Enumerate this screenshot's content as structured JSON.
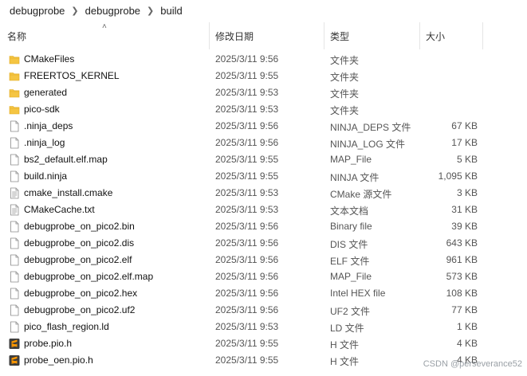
{
  "breadcrumb": [
    "debugprobe",
    "debugprobe",
    "build"
  ],
  "columns": {
    "name": "名称",
    "date": "修改日期",
    "type": "类型",
    "size": "大小"
  },
  "files": [
    {
      "icon": "folder-icon",
      "name": "CMakeFiles",
      "date": "2025/3/11 9:56",
      "type": "文件夹",
      "size": ""
    },
    {
      "icon": "folder-icon",
      "name": "FREERTOS_KERNEL",
      "date": "2025/3/11 9:55",
      "type": "文件夹",
      "size": ""
    },
    {
      "icon": "folder-icon",
      "name": "generated",
      "date": "2025/3/11 9:53",
      "type": "文件夹",
      "size": ""
    },
    {
      "icon": "folder-icon",
      "name": "pico-sdk",
      "date": "2025/3/11 9:53",
      "type": "文件夹",
      "size": ""
    },
    {
      "icon": "file-icon",
      "name": ".ninja_deps",
      "date": "2025/3/11 9:56",
      "type": "NINJA_DEPS 文件",
      "size": "67 KB"
    },
    {
      "icon": "file-icon",
      "name": ".ninja_log",
      "date": "2025/3/11 9:56",
      "type": "NINJA_LOG 文件",
      "size": "17 KB"
    },
    {
      "icon": "file-icon",
      "name": "bs2_default.elf.map",
      "date": "2025/3/11 9:55",
      "type": "MAP_File",
      "size": "5 KB"
    },
    {
      "icon": "file-icon",
      "name": "build.ninja",
      "date": "2025/3/11 9:55",
      "type": "NINJA 文件",
      "size": "1,095 KB"
    },
    {
      "icon": "text-file-icon",
      "name": "cmake_install.cmake",
      "date": "2025/3/11 9:53",
      "type": "CMake 源文件",
      "size": "3 KB"
    },
    {
      "icon": "text-file-icon",
      "name": "CMakeCache.txt",
      "date": "2025/3/11 9:53",
      "type": "文本文档",
      "size": "31 KB"
    },
    {
      "icon": "file-icon",
      "name": "debugprobe_on_pico2.bin",
      "date": "2025/3/11 9:56",
      "type": "Binary file",
      "size": "39 KB"
    },
    {
      "icon": "file-icon",
      "name": "debugprobe_on_pico2.dis",
      "date": "2025/3/11 9:56",
      "type": "DIS 文件",
      "size": "643 KB"
    },
    {
      "icon": "file-icon",
      "name": "debugprobe_on_pico2.elf",
      "date": "2025/3/11 9:56",
      "type": "ELF 文件",
      "size": "961 KB"
    },
    {
      "icon": "file-icon",
      "name": "debugprobe_on_pico2.elf.map",
      "date": "2025/3/11 9:56",
      "type": "MAP_File",
      "size": "573 KB"
    },
    {
      "icon": "file-icon",
      "name": "debugprobe_on_pico2.hex",
      "date": "2025/3/11 9:56",
      "type": "Intel HEX file",
      "size": "108 KB"
    },
    {
      "icon": "file-icon",
      "name": "debugprobe_on_pico2.uf2",
      "date": "2025/3/11 9:56",
      "type": "UF2 文件",
      "size": "77 KB"
    },
    {
      "icon": "file-icon",
      "name": "pico_flash_region.ld",
      "date": "2025/3/11 9:53",
      "type": "LD 文件",
      "size": "1 KB"
    },
    {
      "icon": "sublime-icon",
      "name": "probe.pio.h",
      "date": "2025/3/11 9:55",
      "type": "H 文件",
      "size": "4 KB"
    },
    {
      "icon": "sublime-icon",
      "name": "probe_oen.pio.h",
      "date": "2025/3/11 9:55",
      "type": "H 文件",
      "size": "4 KB"
    }
  ],
  "watermark": "CSDN @perseverance52",
  "colors": {
    "folder": "#f5c542",
    "folder_dark": "#e0a91f",
    "file_border": "#8a8a8a",
    "sublime": "#ff9800",
    "sublime_bg": "#3d3d3d"
  }
}
